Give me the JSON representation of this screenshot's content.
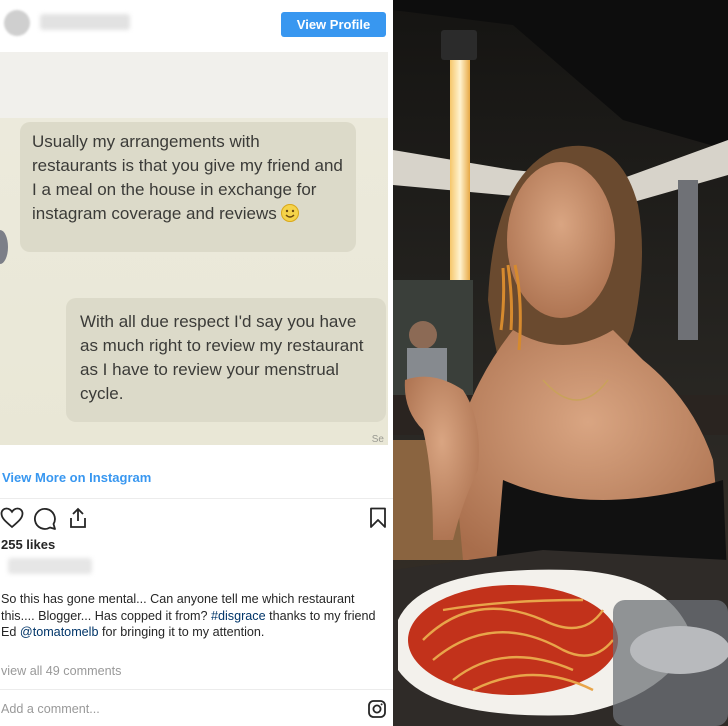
{
  "post": {
    "view_profile_label": "View Profile",
    "screenshot": {
      "message_1": "Usually my arrangements with restaurants is that you give my friend and I a meal on the house in exchange for instagram coverage and reviews",
      "message_2": "With all due respect I'd say you have as much right to review my restaurant as I have to review your menstrual cycle.",
      "corner_text": "Se"
    },
    "view_more_label": "View More on Instagram",
    "likes": "255 likes",
    "caption_part1": "So this has gone mental... Can anyone tell me which restaurant this.... Blogger... Has copped it from? ",
    "caption_hashtag": "#disgrace",
    "caption_part2": " thanks to my friend Ed ",
    "caption_mention": "@tomatomelb",
    "caption_part3": " for bringing it to my attention.",
    "view_all_comments": "view all 49 comments",
    "add_comment_placeholder": "Add a comment..."
  },
  "icons": {
    "like": "heart-icon",
    "comment": "comment-icon",
    "share": "share-icon",
    "save": "bookmark-icon",
    "instagram": "instagram-icon"
  },
  "colors": {
    "accent": "#3897f0",
    "link": "#003569"
  }
}
